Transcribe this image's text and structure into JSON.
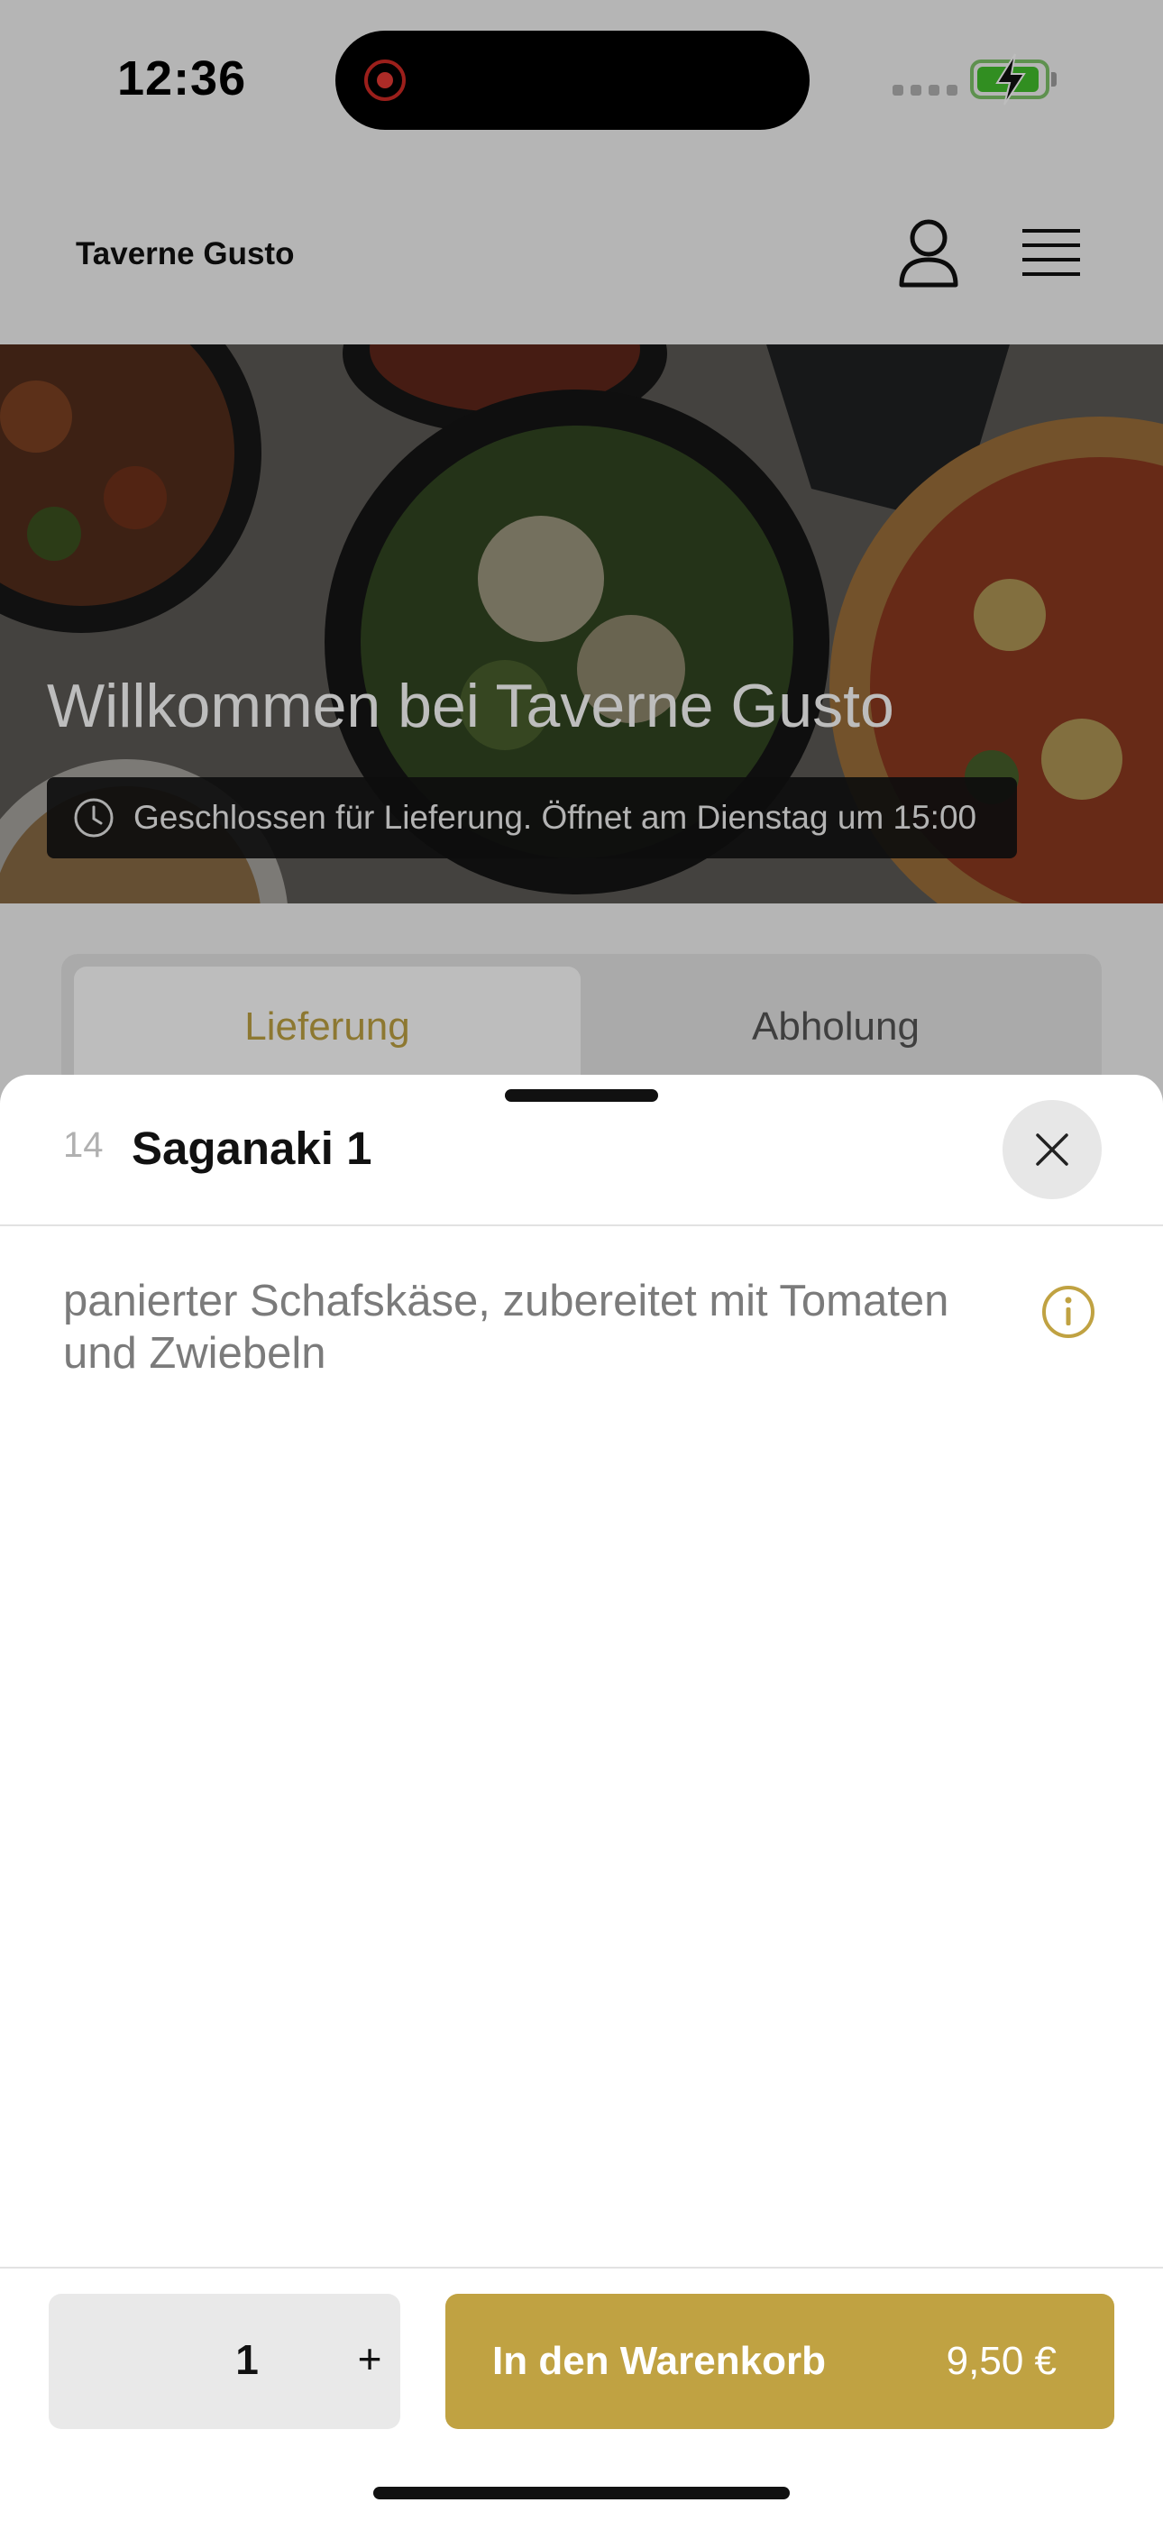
{
  "status_bar": {
    "time": "12:36"
  },
  "header": {
    "restaurant_name": "Taverne Gusto"
  },
  "hero": {
    "welcome_title": "Willkommen bei Taverne Gusto",
    "status_message": "Geschlossen für Lieferung. Öffnet am Dienstag um 15:00"
  },
  "order_mode": {
    "tabs": [
      {
        "label": "Lieferung",
        "active": true
      },
      {
        "label": "Abholung",
        "active": false
      }
    ]
  },
  "item_sheet": {
    "number": "14",
    "title": "Saganaki 1",
    "description": "panierter Schafskäse, zubereitet mit Tomaten und Zwiebeln",
    "quantity": "1",
    "plus_label": "+",
    "add_to_cart_label": "In den Warenkorb",
    "price": "9,50 €"
  },
  "colors": {
    "accent_gold": "#C0A242",
    "active_tab_text": "#BFA243",
    "battery_green": "#43C02D"
  }
}
